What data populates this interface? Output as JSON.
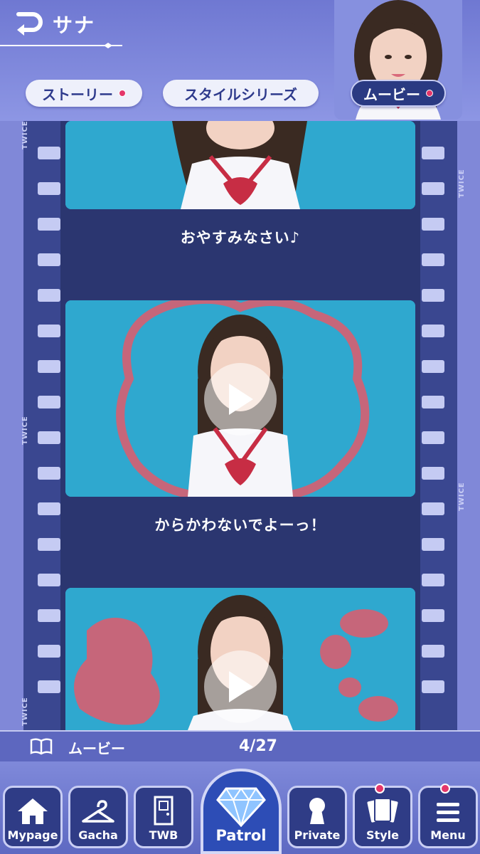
{
  "header": {
    "character_name": "サナ",
    "avatar_icon": "avatar-portrait"
  },
  "tabs": [
    {
      "label": "ストーリー",
      "has_badge": true,
      "active": false
    },
    {
      "label": "スタイルシリーズ",
      "has_badge": false,
      "active": false
    },
    {
      "label": "ムービー",
      "has_badge": true,
      "active": true
    }
  ],
  "film": {
    "strip_text": "TWICE",
    "captions": [
      "おやすみなさい♪",
      "からかわないでよーっ！"
    ]
  },
  "info_bar": {
    "icon": "book-icon",
    "label": "ムービー",
    "count": "4/27"
  },
  "nav": {
    "items": [
      {
        "label": "Mypage",
        "icon": "home-icon",
        "badge": false
      },
      {
        "label": "Gacha",
        "icon": "hanger-icon",
        "badge": false
      },
      {
        "label": "TWB",
        "icon": "door-icon",
        "badge": false
      },
      {
        "label": "Patrol",
        "icon": "diamond-icon",
        "badge": false
      },
      {
        "label": "Private",
        "icon": "keyhole-icon",
        "badge": false
      },
      {
        "label": "Style",
        "icon": "cards-icon",
        "badge": true
      },
      {
        "label": "Menu",
        "icon": "hamburger-icon",
        "badge": true
      }
    ]
  },
  "colors": {
    "badge": "#e4366a",
    "nav_bg": "#2f3c86",
    "accent": "#2d4db6"
  }
}
